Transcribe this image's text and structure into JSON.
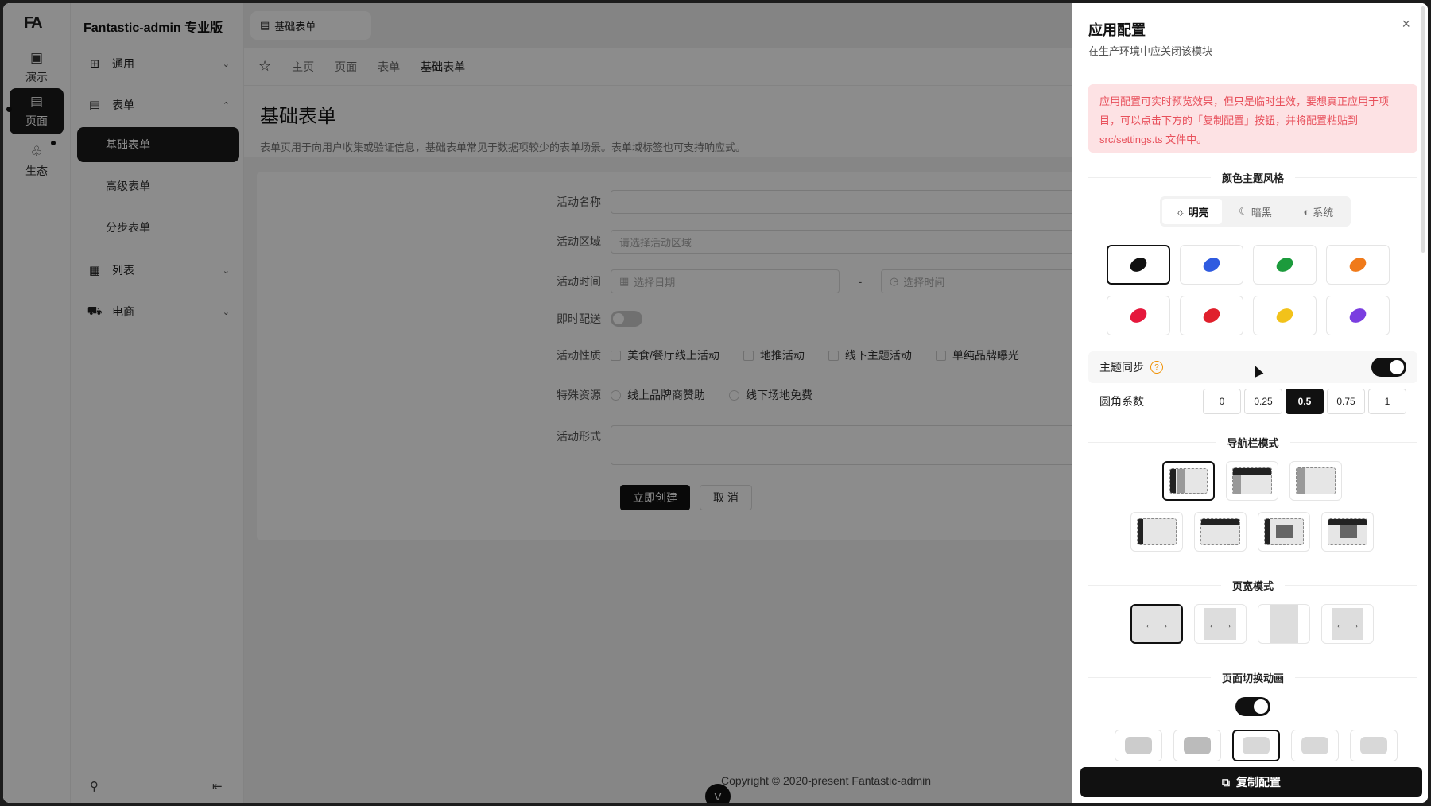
{
  "rail": {
    "logo": "FA",
    "items": [
      {
        "label": "演示",
        "icon": "cube-icon"
      },
      {
        "label": "页面",
        "icon": "document-icon"
      },
      {
        "label": "生态",
        "icon": "ecosystem-icon"
      }
    ]
  },
  "menu": {
    "app_title": "Fantastic-admin 专业版",
    "groups": [
      {
        "label": "通用",
        "icon": "grid-icon",
        "expanded": false
      },
      {
        "label": "表单",
        "icon": "form-icon",
        "expanded": true
      },
      {
        "label": "列表",
        "icon": "table-icon",
        "expanded": false
      },
      {
        "label": "电商",
        "icon": "cart-icon",
        "expanded": false
      }
    ],
    "subitems": [
      "基础表单",
      "高级表单",
      "分步表单"
    ],
    "active_sub": "基础表单"
  },
  "tabbar": {
    "tab_label": "基础表单"
  },
  "breadcrumb": [
    "主页",
    "页面",
    "表单",
    "基础表单"
  ],
  "page": {
    "title": "基础表单",
    "description": "表单页用于向用户收集或验证信息，基础表单常见于数据项较少的表单场景。表单域标签也可支持响应式。"
  },
  "form": {
    "name_label": "活动名称",
    "region_label": "活动区域",
    "region_placeholder": "请选择活动区域",
    "time_label": "活动时间",
    "date_placeholder": "选择日期",
    "time_placeholder": "选择时间",
    "time_sep": "-",
    "delivery_label": "即时配送",
    "nature_label": "活动性质",
    "nature_options": [
      "美食/餐厅线上活动",
      "地推活动",
      "线下主题活动",
      "单纯品牌曝光"
    ],
    "resource_label": "特殊资源",
    "resource_options": [
      "线上品牌商赞助",
      "线下场地免费"
    ],
    "form_label": "活动形式",
    "submit": "立即创建",
    "cancel": "取 消"
  },
  "footer": {
    "copyright": "Copyright © 2020-present  Fantastic-admin",
    "scroll_icon": "V"
  },
  "drawer": {
    "title": "应用配置",
    "subtitle": "在生产环境中应关闭该模块",
    "close": "×",
    "alert": "应用配置可实时预览效果，但只是临时生效，要想真正应用于项目，可以点击下方的「复制配置」按钮，并将配置粘贴到 src/settings.ts 文件中。",
    "color_theme_title": "颜色主题风格",
    "modes": [
      {
        "label": "明亮",
        "icon": "☼"
      },
      {
        "label": "暗黑",
        "icon": "☾"
      },
      {
        "label": "系统",
        "icon": "◐"
      }
    ],
    "active_mode": "明亮",
    "swatches": [
      "#111111",
      "#2f5be0",
      "#1c9b3c",
      "#f07a1a",
      "#e5183c",
      "#e0202c",
      "#f2c21a",
      "#7a3ee0"
    ],
    "active_swatch": 0,
    "theme_sync_label": "主题同步",
    "theme_sync_on": true,
    "radius_label": "圆角系数",
    "radius_options": [
      "0",
      "0.25",
      "0.5",
      "0.75",
      "1"
    ],
    "radius_active": "0.5",
    "nav_mode_title": "导航栏模式",
    "width_mode_title": "页宽模式",
    "width_arrows": "←  →",
    "anim_title": "页面切换动画",
    "anim_on": true,
    "copy_button": "复制配置"
  }
}
